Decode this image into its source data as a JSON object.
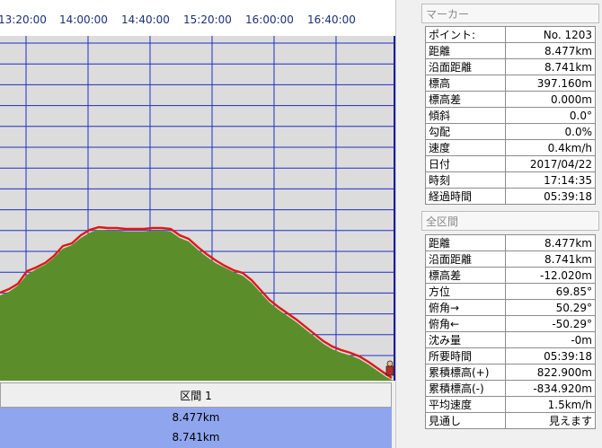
{
  "time_axis": {
    "ticks": [
      "13:20:00",
      "14:00:00",
      "14:40:00",
      "15:20:00",
      "16:00:00",
      "16:40:00"
    ]
  },
  "profile_colors": {
    "plot_bg": "#dcdcdc",
    "grid": "#1f2fc4",
    "fill": "#5b8e2a",
    "line": "#e21717",
    "section_values_bg": "#8fa6ee"
  },
  "section": {
    "label": "区間 1",
    "distance": "8.477km",
    "surface_distance": "8.741km"
  },
  "marker_panel": {
    "title": "マーカー",
    "rows": [
      {
        "label": "ポイント:",
        "value": "No. 1203"
      },
      {
        "label": "距離",
        "value": "8.477km"
      },
      {
        "label": "沿面距離",
        "value": "8.741km"
      },
      {
        "label": "標高",
        "value": "397.160m"
      },
      {
        "label": "標高差",
        "value": "0.000m"
      },
      {
        "label": "傾斜",
        "value": "0.0°"
      },
      {
        "label": "勾配",
        "value": "0.0%"
      },
      {
        "label": "速度",
        "value": "0.4km/h"
      },
      {
        "label": "日付",
        "value": "2017/04/22"
      },
      {
        "label": "時刻",
        "value": "17:14:35"
      },
      {
        "label": "経過時間",
        "value": "05:39:18"
      }
    ]
  },
  "section_panel": {
    "title": "全区間",
    "rows": [
      {
        "label": "距離",
        "value": "8.477km"
      },
      {
        "label": "沿面距離",
        "value": "8.741km"
      },
      {
        "label": "標高差",
        "value": "-12.020m"
      },
      {
        "label": "方位",
        "value": "69.85°"
      },
      {
        "label": "俯角→",
        "value": "50.29°"
      },
      {
        "label": "俯角←",
        "value": "-50.29°"
      },
      {
        "label": "沈み量",
        "value": "-0m"
      },
      {
        "label": "所要時間",
        "value": "05:39:18"
      },
      {
        "label": "累積標高(+)",
        "value": "822.900m"
      },
      {
        "label": "累積標高(-)",
        "value": "-834.920m"
      },
      {
        "label": "平均速度",
        "value": "1.5km/h"
      },
      {
        "label": "見通し",
        "value": "見えます"
      }
    ]
  }
}
